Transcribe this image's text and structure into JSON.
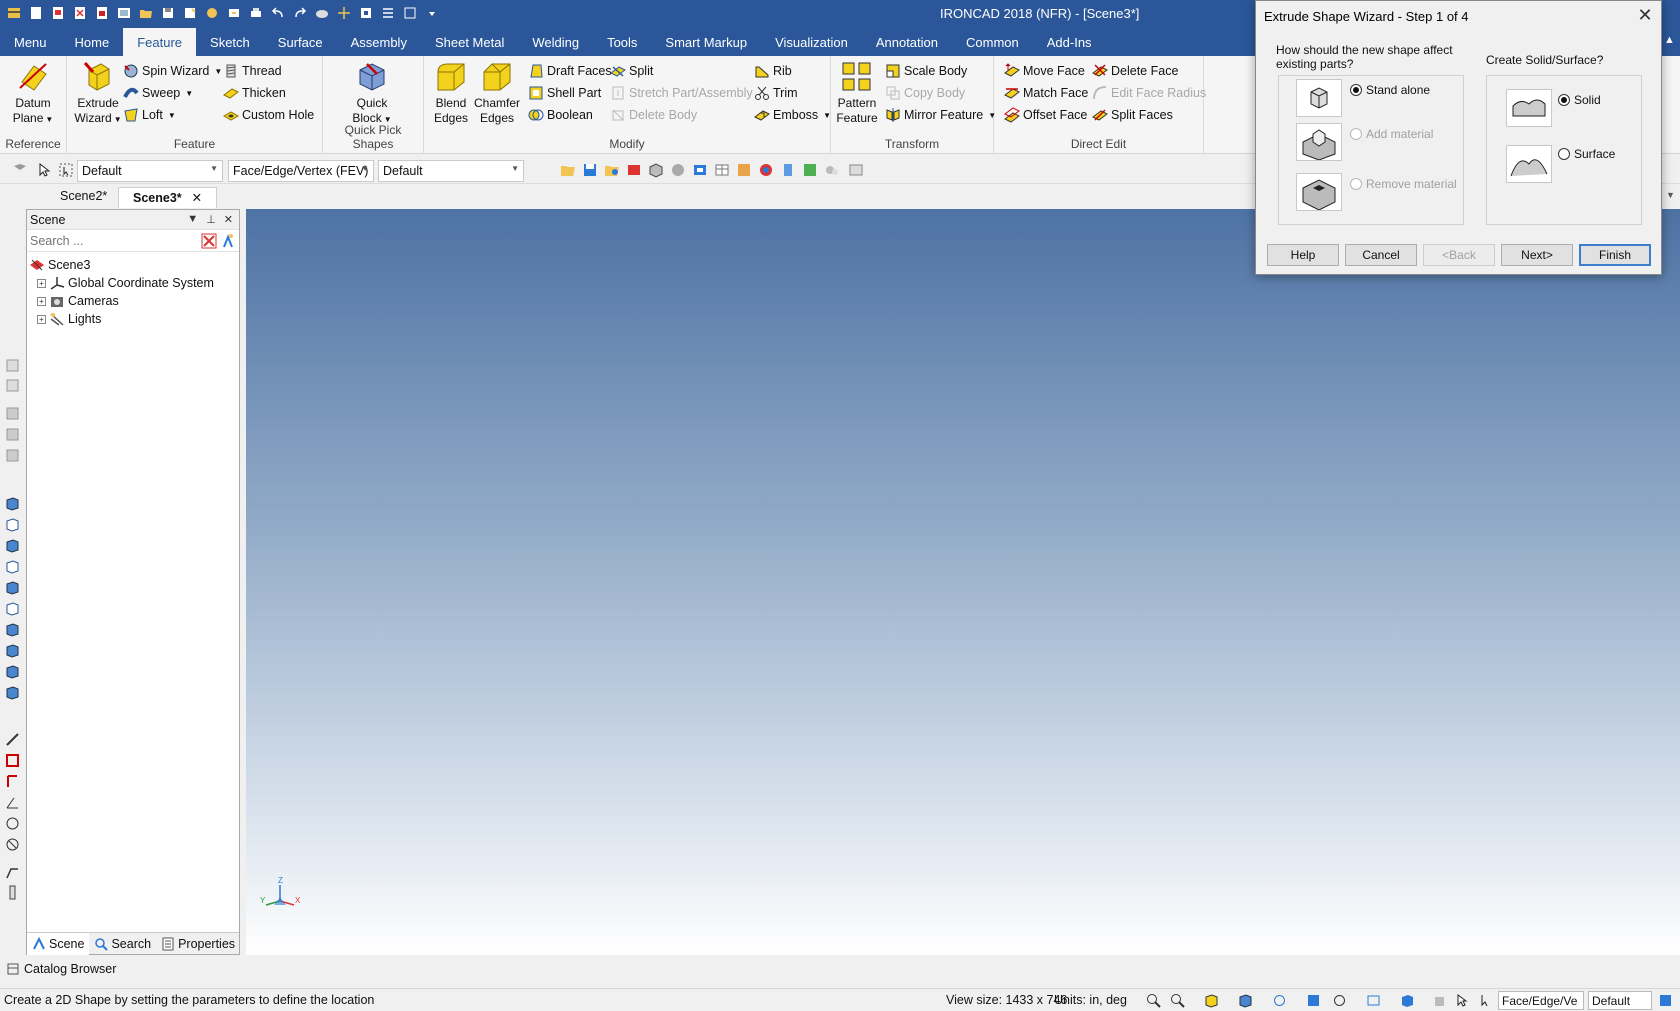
{
  "app_title": "IRONCAD 2018 (NFR) - [Scene3*]",
  "ribbon_tabs": [
    "Menu",
    "Home",
    "Feature",
    "Sketch",
    "Surface",
    "Assembly",
    "Sheet Metal",
    "Welding",
    "Tools",
    "Smart Markup",
    "Visualization",
    "Annotation",
    "Common",
    "Add-Ins"
  ],
  "active_tab": "Feature",
  "groups": {
    "reference": {
      "label": "Reference",
      "datum_plane_1": "Datum",
      "datum_plane_2": "Plane"
    },
    "feature": {
      "label": "Feature",
      "extrude_1": "Extrude",
      "extrude_2": "Wizard",
      "spin_wizard": "Spin Wizard",
      "sweep": "Sweep",
      "loft": "Loft",
      "thread": "Thread",
      "thicken": "Thicken",
      "custom_hole": "Custom Hole"
    },
    "quick_pick": {
      "label": "Quick Pick Shapes",
      "quick_block_1": "Quick",
      "quick_block_2": "Block"
    },
    "modify": {
      "label": "Modify",
      "blend_1": "Blend",
      "blend_2": "Edges",
      "chamfer_1": "Chamfer",
      "chamfer_2": "Edges",
      "draft_faces": "Draft Faces",
      "shell_part": "Shell Part",
      "boolean": "Boolean",
      "split": "Split",
      "stretch": "Stretch Part/Assembly",
      "delete_body": "Delete Body",
      "rib": "Rib",
      "trim": "Trim",
      "emboss": "Emboss"
    },
    "transform": {
      "label": "Transform",
      "pattern_1": "Pattern",
      "pattern_2": "Feature",
      "scale_body": "Scale Body",
      "copy_body": "Copy Body",
      "mirror_feature": "Mirror Feature"
    },
    "direct_edit": {
      "label": "Direct Edit",
      "move_face": "Move Face",
      "match_face": "Match Face",
      "offset_face": "Offset Face",
      "delete_face": "Delete Face",
      "edit_face_radius": "Edit Face Radius",
      "split_faces": "Split Faces"
    }
  },
  "toolbar": {
    "combo1": "Default",
    "combo2": "Face/Edge/Vertex (FEV)",
    "combo3": "Default"
  },
  "doc_tabs": {
    "tab1": "Scene2*",
    "tab2": "Scene3*"
  },
  "scene_panel": {
    "title": "Scene",
    "search_placeholder": "Search ...",
    "tree": {
      "root": "Scene3",
      "item1": "Global Coordinate System",
      "item2": "Cameras",
      "item3": "Lights"
    },
    "bottom_tabs": {
      "scene": "Scene",
      "search": "Search",
      "properties": "Properties"
    }
  },
  "axes": {
    "x": "X",
    "y": "Y",
    "z": "Z"
  },
  "catalog_browser": "Catalog Browser",
  "status": {
    "message": "Create a 2D Shape by setting the parameters to define the location",
    "view_size": "View size: 1433 x  746",
    "units": "Units: in, deg",
    "combo_sel": "Face/Edge/Ve",
    "combo_default": "Default"
  },
  "dialog": {
    "title": "Extrude Shape Wizard - Step 1 of 4",
    "question1": "How should the new shape affect existing parts?",
    "question2": "Create Solid/Surface?",
    "opt_stand_alone": "Stand alone",
    "opt_add_material": "Add material",
    "opt_remove_material": "Remove material",
    "opt_solid": "Solid",
    "opt_surface": "Surface",
    "btn_help": "Help",
    "btn_cancel": "Cancel",
    "btn_back": "<Back",
    "btn_next": "Next>",
    "btn_finish": "Finish"
  },
  "colors": {
    "title_bar": "#2b579a",
    "accent": "#3c7fd1"
  }
}
